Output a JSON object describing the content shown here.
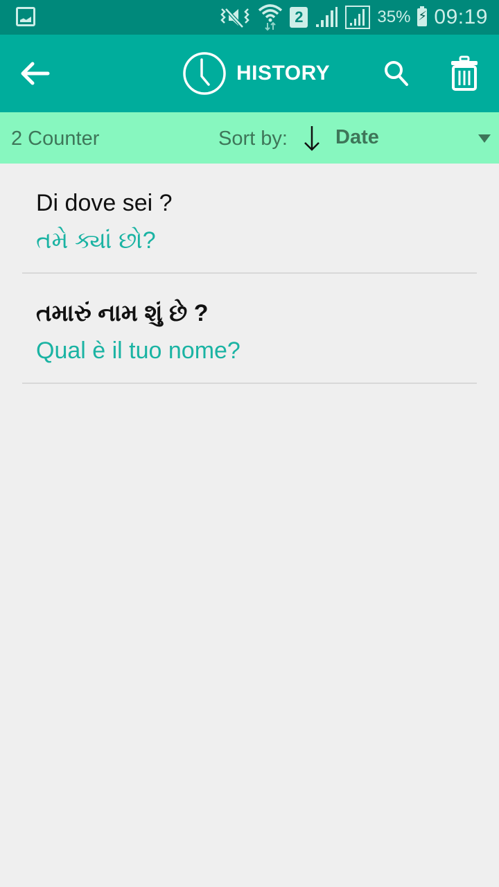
{
  "status_bar": {
    "icons": [
      "gallery-icon",
      "vibrate-mute-icon",
      "wifi-icon",
      "sim-2-icon",
      "signal-icon",
      "signal-icon",
      "battery-charging-icon"
    ],
    "sim_label": "2",
    "battery_percent": "35%",
    "time": "09:19"
  },
  "app_bar": {
    "back_icon": "arrow-left-icon",
    "title_icon": "clock-icon",
    "title": "HISTORY",
    "search_icon": "search-icon",
    "delete_icon": "trash-icon"
  },
  "sort_bar": {
    "counter": "2 Counter",
    "sort_label": "Sort by:",
    "sort_direction_icon": "arrow-down-icon",
    "sort_value": "Date",
    "dropdown_icon": "triangle-down-icon"
  },
  "history": [
    {
      "source": "Di dove sei ?",
      "translation": "તમે ક્યાં છો?"
    },
    {
      "source": "તમારું નામ શું છે ?",
      "translation": "Qual è il tuo nome?"
    }
  ],
  "colors": {
    "status_bar": "#00897b",
    "app_bar": "#00ad9c",
    "sort_bar": "#87f7bf",
    "translation_text": "#1ab3a3",
    "background": "#efefef"
  }
}
